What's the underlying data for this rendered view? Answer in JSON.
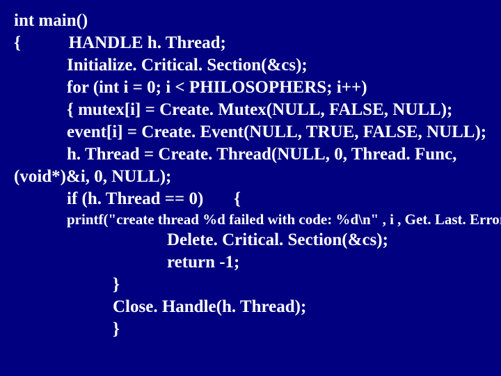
{
  "code": {
    "l1": "int main()",
    "l2": "{           HANDLE h. Thread;",
    "l3": "Initialize. Critical. Section(&cs);",
    "l4": "for (int i = 0; i < PHILOSOPHERS; i++)",
    "l5": "{ mutex[i] = Create. Mutex(NULL, FALSE, NULL);",
    "l6": "event[i] = Create. Event(NULL, TRUE, FALSE, NULL);",
    "l7": "h. Thread = Create. Thread(NULL, 0, Thread. Func,",
    "l8": "(void*)&i, 0, NULL);",
    "l9": "if (h. Thread == 0)       {",
    "l10": "printf(\"create thread %d failed with code: %d\\n\" , i , Get. Last. Error());",
    "l11": "Delete. Critical. Section(&cs);",
    "l12": "return -1;",
    "l13": "}",
    "l14": "Close. Handle(h. Thread);",
    "l15": "}"
  }
}
